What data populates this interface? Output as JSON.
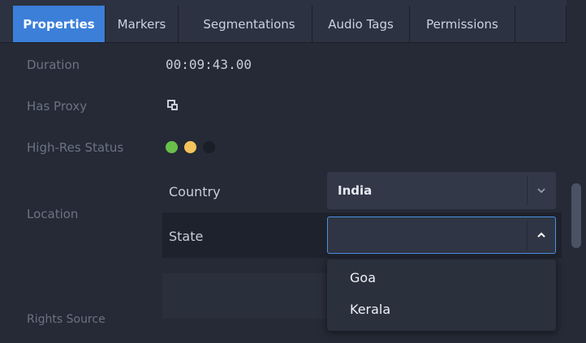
{
  "tabs": [
    {
      "label": "Properties",
      "active": true
    },
    {
      "label": "Markers",
      "active": false
    },
    {
      "label": "Segmentations",
      "active": false
    },
    {
      "label": "Audio Tags",
      "active": false
    },
    {
      "label": "Permissions",
      "active": false
    }
  ],
  "properties": {
    "duration_label": "Duration",
    "duration_value": "00:09:43.00",
    "has_proxy_label": "Has Proxy",
    "has_proxy_icon": "proxy-icon",
    "high_res_label": "High-Res Status",
    "status_dots": [
      "#6abf4b",
      "#f5c35b",
      "#1a1e26"
    ],
    "location_label": "Location",
    "rights_source_label": "Rights Source"
  },
  "location": {
    "country_label": "Country",
    "country_value": "India",
    "state_label": "State",
    "state_value": "",
    "state_options": [
      "Goa",
      "Kerala"
    ]
  },
  "colors": {
    "accent": "#3b7fd9",
    "focus_border": "#4a90e2",
    "background": "#252a36"
  }
}
